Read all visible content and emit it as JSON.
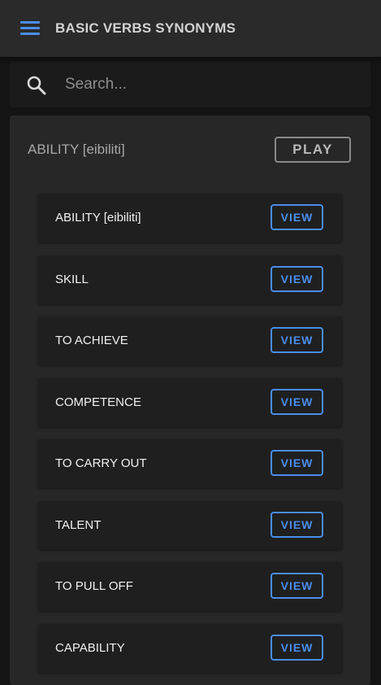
{
  "appbar": {
    "title": "BASIC VERBS SYNONYMS",
    "menu_icon": "hamburger-menu-icon",
    "accent_color": "#4a8de9"
  },
  "search": {
    "placeholder": "Search...",
    "value": "",
    "icon": "search-icon"
  },
  "card": {
    "title": "ABILITY [eibiliti]",
    "play_label": "PLAY",
    "items": [
      {
        "label": "ABILITY [eibiliti]",
        "button": "VIEW"
      },
      {
        "label": "SKILL",
        "button": "VIEW"
      },
      {
        "label": "TO ACHIEVE",
        "button": "VIEW"
      },
      {
        "label": "COMPETENCE",
        "button": "VIEW"
      },
      {
        "label": "TO CARRY OUT",
        "button": "VIEW"
      },
      {
        "label": "TALENT",
        "button": "VIEW"
      },
      {
        "label": "TO PULL OFF",
        "button": "VIEW"
      },
      {
        "label": "CAPABILITY",
        "button": "VIEW"
      }
    ]
  }
}
